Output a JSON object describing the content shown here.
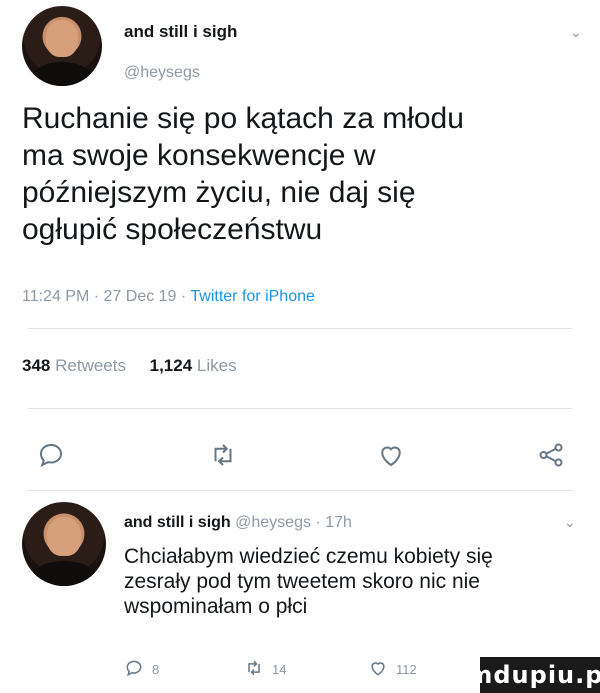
{
  "tweet": {
    "author_name": "and still i sigh",
    "author_handle": "@heysegs",
    "text_lines": [
      "Ruchanie się po kątach za młodu",
      "ma swoje konsekwencje w",
      "późniejszym życiu, nie daj się",
      "ogłupić społeczeństwu"
    ],
    "timestamp": "11:24 PM · 27 Dec 19 · ",
    "client": "Twitter for iPhone",
    "retweets_count": "348",
    "retweets_label": "Retweets",
    "likes_count": "1,124",
    "likes_label": "Likes",
    "icons": [
      "reply-icon",
      "retweet-icon",
      "like-icon",
      "share-icon"
    ]
  },
  "reply": {
    "author_name": "and still i sigh",
    "author_meta": "@heysegs · 17h",
    "text_lines": [
      "Chciałabym wiedzieć czemu kobiety się",
      "zesrały pod tym tweetem skoro nic nie",
      "wspominałam o płci"
    ],
    "reply_count": "8",
    "retweet_count": "14",
    "like_count": "112"
  },
  "watermark": "mdupiu.pl"
}
